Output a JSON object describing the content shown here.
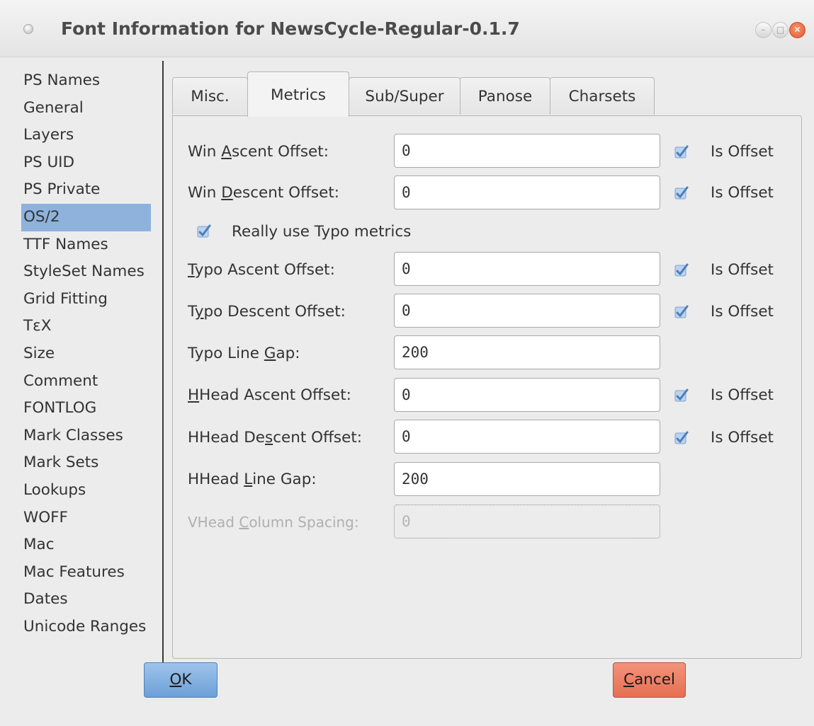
{
  "window": {
    "title": "Font Information for NewsCycle-Regular-0.1.7",
    "controls": {
      "minimize": "–",
      "maximize": "□",
      "close": "✕"
    }
  },
  "sidebar": {
    "items": [
      "PS Names",
      "General",
      "Layers",
      "PS UID",
      "PS Private",
      "OS/2",
      "TTF Names",
      "StyleSet Names",
      "Grid Fitting",
      "TεX",
      "Size",
      "Comment",
      "FONTLOG",
      "Mark Classes",
      "Mark Sets",
      "Lookups",
      "WOFF",
      "Mac",
      "Mac Features",
      "Dates",
      "Unicode Ranges"
    ],
    "selected": "OS/2"
  },
  "tabs": [
    "Misc.",
    "Metrics",
    "Sub/Super",
    "Panose",
    "Charsets"
  ],
  "active_tab": "Metrics",
  "metrics": {
    "win_ascent": {
      "l1": "Win ",
      "m": "A",
      "l2": "scent Offset:",
      "value": "0",
      "is_offset": true
    },
    "win_descent": {
      "l1": "Win ",
      "m": "D",
      "l2": "escent Offset:",
      "value": "0",
      "is_offset": true
    },
    "really_use_typo": {
      "label": "Really use Typo metrics",
      "checked": true
    },
    "typo_ascent": {
      "l1": "",
      "m": "T",
      "l2": "ypo Ascent Offset:",
      "value": "0",
      "is_offset": true
    },
    "typo_descent": {
      "l1": "T",
      "m": "y",
      "l2": "po Descent Offset:",
      "value": "0",
      "is_offset": true
    },
    "typo_line_gap": {
      "l1": "Typo Line ",
      "m": "G",
      "l2": "ap:",
      "value": "200"
    },
    "hhead_ascent": {
      "l1": "",
      "m": "H",
      "l2": "Head Ascent Offset:",
      "value": "0",
      "is_offset": true
    },
    "hhead_descent": {
      "l1": "HHead De",
      "m": "s",
      "l2": "cent Offset:",
      "value": "0",
      "is_offset": true
    },
    "hhead_line_gap": {
      "l1": "HHead ",
      "m": "L",
      "l2": "ine Gap:",
      "value": "200"
    },
    "vhead_column_spacing": {
      "l1": "VHead ",
      "m": "C",
      "l2": "olumn Spacing:",
      "value": "0",
      "disabled": true
    },
    "is_offset_label": "Is Offset"
  },
  "buttons": {
    "ok": {
      "m": "O",
      "rest": "K"
    },
    "cancel": {
      "m": "C",
      "rest": "ancel"
    }
  },
  "colors": {
    "selection": "#8eb2dc",
    "ok_button": "#6c9fd6",
    "cancel_button": "#e56f52",
    "check_mark": "#4a7fbf"
  }
}
